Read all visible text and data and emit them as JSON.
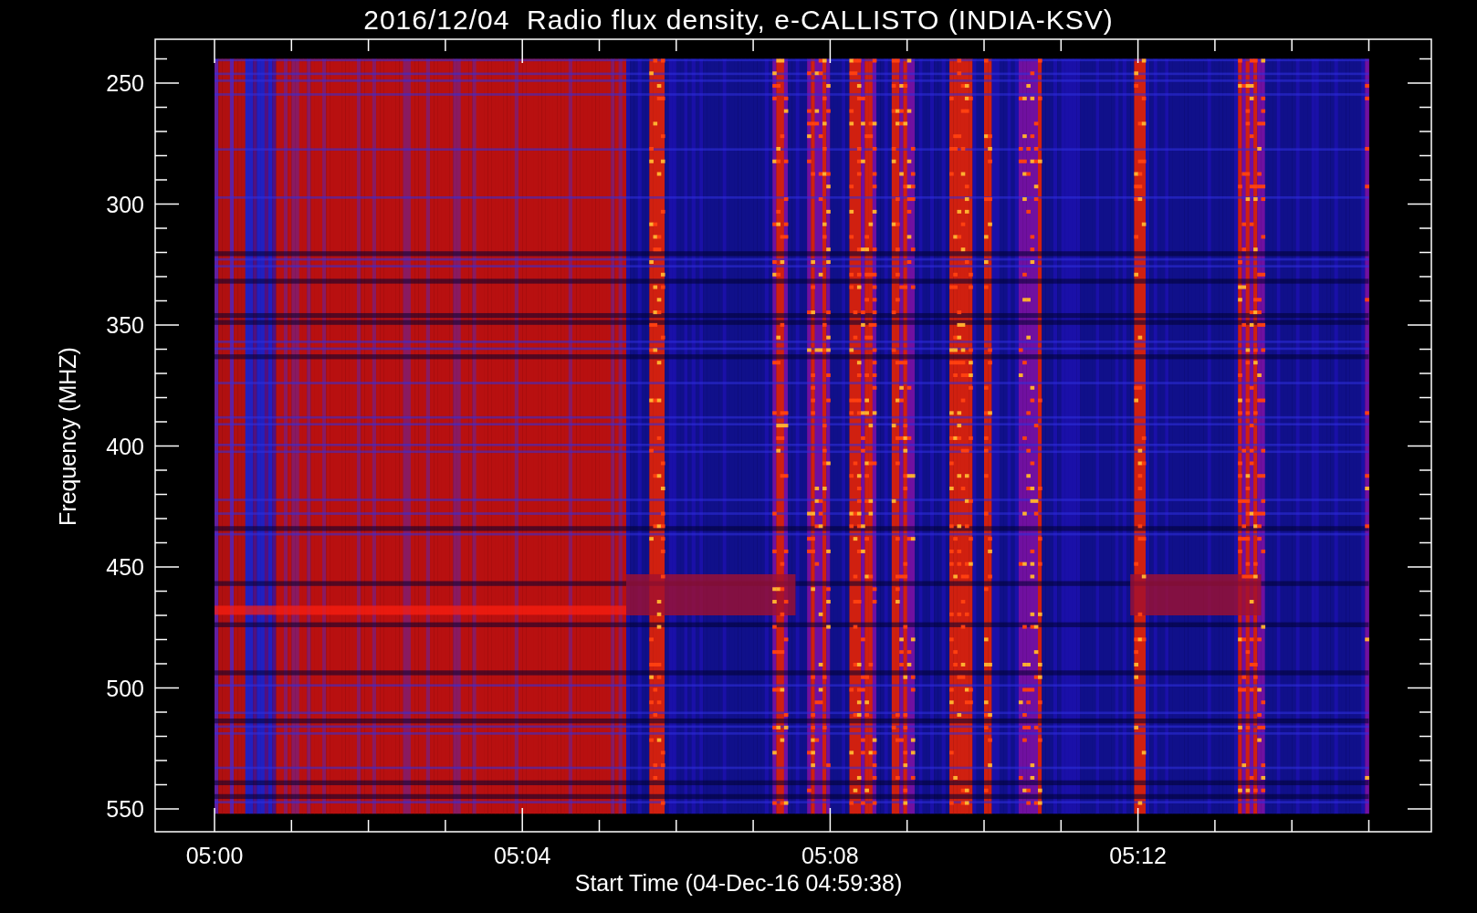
{
  "title": "2016/12/04  Radio flux density, e-CALLISTO (INDIA-KSV)",
  "y_axis": {
    "label": "Frequency (MHZ)",
    "ticks": [
      "250",
      "300",
      "350",
      "400",
      "450",
      "500",
      "550"
    ]
  },
  "x_axis": {
    "label": "Start Time (04-Dec-16 04:59:38)",
    "ticks": [
      "05:00",
      "05:04",
      "05:08",
      "05:12"
    ]
  }
}
